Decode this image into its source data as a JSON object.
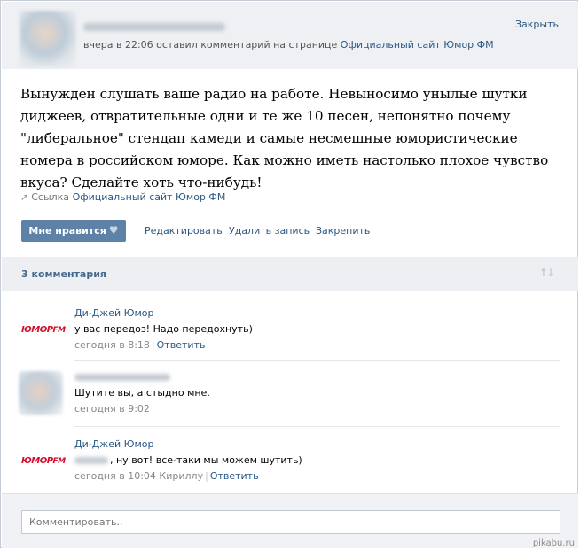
{
  "post": {
    "meta_prefix": "вчера в 22:06 оставил комментарий на странице",
    "page_link": "Официальный сайт Юмор ФМ",
    "close_label": "Закрыть",
    "text": "Вынужден слушать ваше радио на работе. Невыносимо унылые шутки диджеев, отвратительные одни и те же 10 песен, непонятно почему \"либеральное\" стендап камеди и самые несмешные юмористические номера в российском юморе. Как можно иметь настолько плохое чувство вкуса? Сделайте хоть что-нибудь!",
    "link_prefix": "Ссылка",
    "link_name": "Официальный сайт Юмор ФМ"
  },
  "actions": {
    "like_label": "Мне нравится",
    "edit_label": "Редактировать",
    "delete_label": "Удалить запись",
    "pin_label": "Закрепить"
  },
  "comments_header": {
    "count_label": "3 комментария"
  },
  "comments": [
    {
      "author": "Ди-Джей Юмор",
      "text": "у вас передоз! Надо передохнуть)",
      "time": "сегодня в 8:18",
      "reply_label": "Ответить",
      "logo_text": "ЮМОР",
      "logo_fm": "FM"
    },
    {
      "text": "Шутите вы, а стыдно мне.",
      "time": "сегодня в 9:02"
    },
    {
      "author": "Ди-Джей Юмор",
      "text": ", ну вот! все-таки мы можем шутить)",
      "time": "сегодня в 10:04",
      "time_addressee": "Кириллу",
      "reply_label": "Ответить",
      "logo_text": "ЮМОР",
      "logo_fm": "FM"
    }
  ],
  "reply": {
    "placeholder": "Комментировать.."
  },
  "watermark": "pikabu.ru"
}
